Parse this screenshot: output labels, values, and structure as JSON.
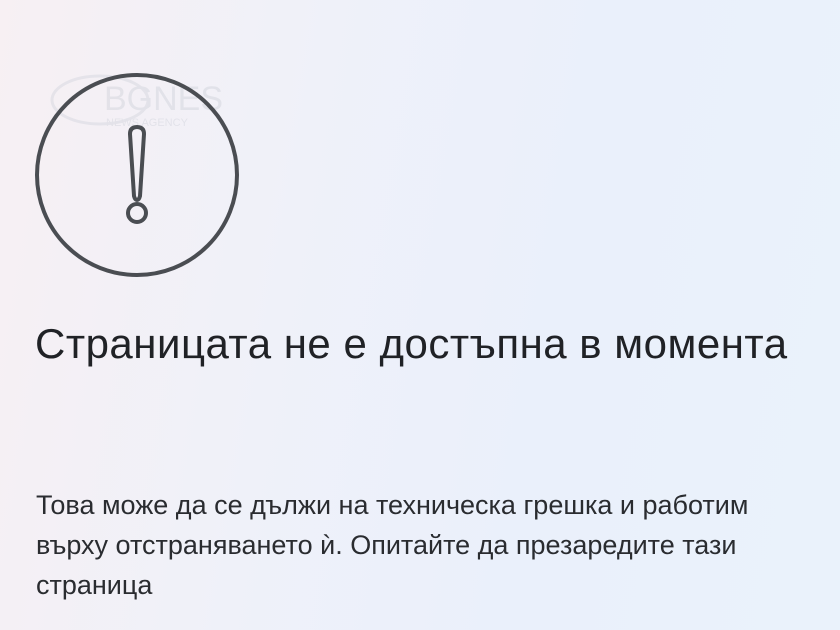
{
  "watermark": {
    "brand": "BGNES",
    "tagline": "NEWS AGENCY"
  },
  "error_page": {
    "icon": "exclamation-circle-icon",
    "title": "Страницата не е достъпна в момента",
    "message": "Това може да се дължи на техническа грешка и работим върху отстраняването ѝ. Опитайте да презаредите тази страница"
  },
  "colors": {
    "icon_stroke": "#4a4d52",
    "text": "#202226"
  }
}
